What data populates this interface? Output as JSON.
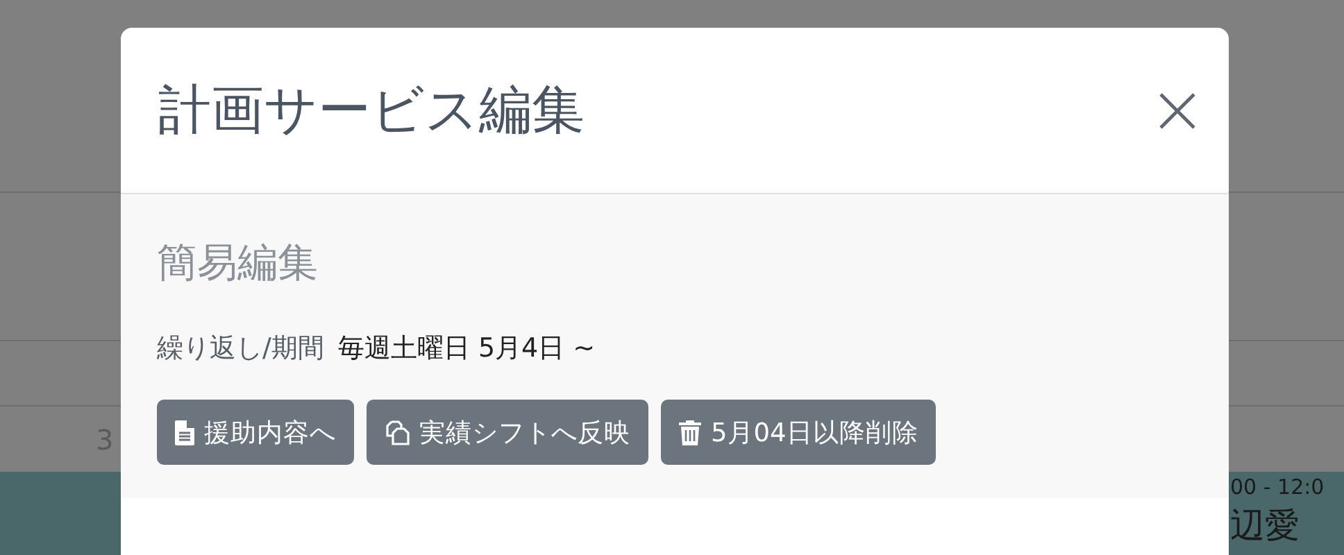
{
  "background": {
    "row_text": "3",
    "event": {
      "time": "00 - 12:0",
      "name": "辺愛"
    }
  },
  "modal": {
    "title": "計画サービス編集",
    "section": {
      "heading": "簡易編集",
      "label": "繰り返し/期間",
      "value": "毎週土曜日 5月4日 ~"
    },
    "buttons": [
      {
        "kind": "file",
        "label": "援助内容へ"
      },
      {
        "kind": "copy",
        "label": "実績シフトへ反映"
      },
      {
        "kind": "trash",
        "label": "5月04日以降削除"
      }
    ]
  }
}
